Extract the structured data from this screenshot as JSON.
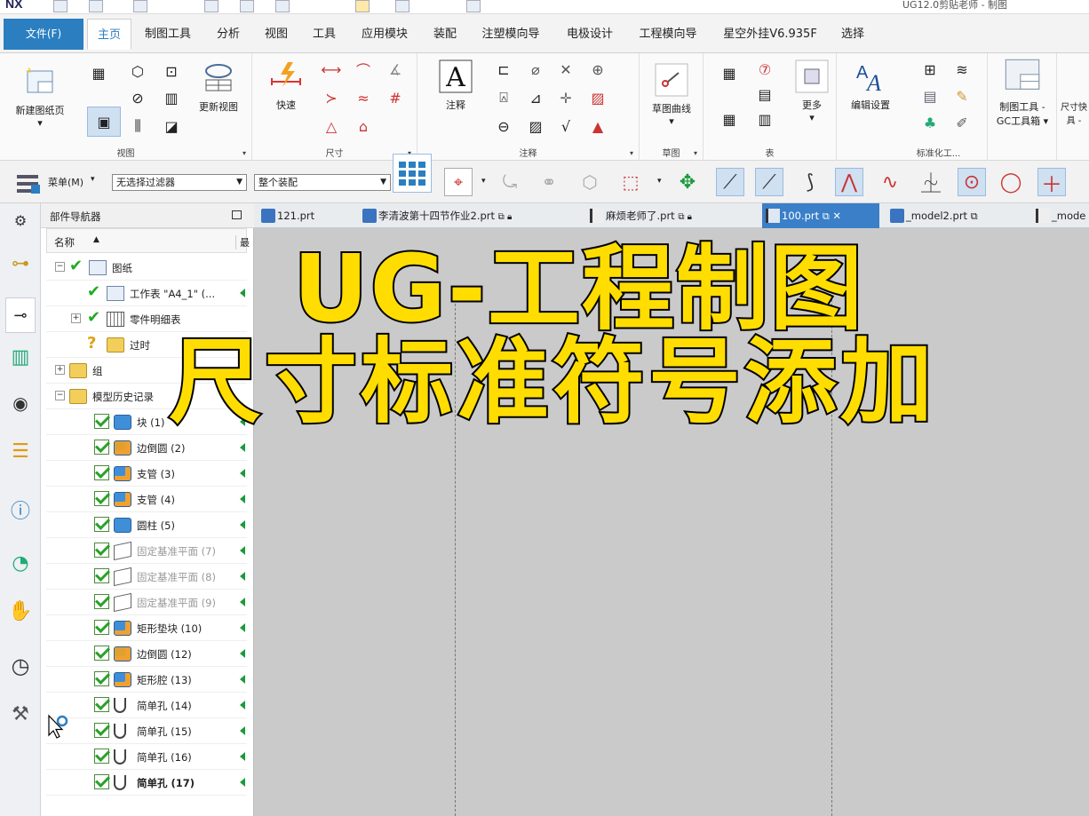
{
  "titlebar": {
    "logo": "NX",
    "window_title": "UG12.0剪贴老师 - 制图"
  },
  "menu": {
    "file": "文件(F)",
    "tabs": [
      "主页",
      "制图工具",
      "分析",
      "视图",
      "工具",
      "应用模块",
      "装配",
      "注塑模向导",
      "电极设计",
      "工程模向导",
      "星空外挂V6.935F",
      "选择"
    ],
    "active": "主页"
  },
  "ribbon": {
    "new_sheet": "新建图纸页",
    "update_view": "更新视图",
    "view_group": "视图",
    "quick": "快速",
    "dim_group": "尺寸",
    "note": "注释",
    "note_group": "注释",
    "sketch_curve": "草图曲线",
    "sketch_group": "草图",
    "more": "更多",
    "table_group": "表",
    "edit_settings": "编辑设置",
    "gc_tools": "制图工具 - GC工具箱",
    "std_group": "标准化工...",
    "dim_quick_tool": "尺寸快 具 -"
  },
  "cmdbar": {
    "menu": "菜单(M)",
    "filter": "无选择过滤器",
    "assembly": "整个装配"
  },
  "navigator": {
    "title": "部件导航器",
    "col_name": "名称",
    "col_short": "最",
    "rows": [
      {
        "label": "图纸",
        "indent": 0,
        "type": "sheet-root"
      },
      {
        "label": "工作表 \"A4_1\" (...",
        "indent": 1,
        "type": "sheet"
      },
      {
        "label": "零件明细表",
        "indent": 1,
        "type": "table"
      },
      {
        "label": "过时",
        "indent": 1,
        "type": "outdated"
      },
      {
        "label": "组",
        "indent": 0,
        "type": "group"
      },
      {
        "label": "模型历史记录",
        "indent": 0,
        "type": "history"
      },
      {
        "label": "块 (1)",
        "indent": 2,
        "type": "block",
        "style": ""
      },
      {
        "label": "边倒圆 (2)",
        "indent": 2,
        "type": "blend",
        "style": ""
      },
      {
        "label": "支管 (3)",
        "indent": 2,
        "type": "boss",
        "style": ""
      },
      {
        "label": "支管 (4)",
        "indent": 2,
        "type": "boss",
        "style": ""
      },
      {
        "label": "圆柱 (5)",
        "indent": 2,
        "type": "cylinder",
        "style": ""
      },
      {
        "label": "固定基准平面 (7)",
        "indent": 2,
        "type": "plane",
        "style": "grey"
      },
      {
        "label": "固定基准平面 (8)",
        "indent": 2,
        "type": "plane",
        "style": "grey"
      },
      {
        "label": "固定基准平面 (9)",
        "indent": 2,
        "type": "plane",
        "style": "grey"
      },
      {
        "label": "矩形垫块 (10)",
        "indent": 2,
        "type": "pad",
        "style": ""
      },
      {
        "label": "边倒圆 (12)",
        "indent": 2,
        "type": "blend",
        "style": ""
      },
      {
        "label": "矩形腔 (13)",
        "indent": 2,
        "type": "pocket",
        "style": ""
      },
      {
        "label": "简单孔 (14)",
        "indent": 2,
        "type": "hole",
        "style": ""
      },
      {
        "label": "简单孔 (15)",
        "indent": 2,
        "type": "hole",
        "style": ""
      },
      {
        "label": "简单孔 (16)",
        "indent": 2,
        "type": "hole",
        "style": ""
      },
      {
        "label": "简单孔 (17)",
        "indent": 2,
        "type": "hole",
        "style": "bold"
      }
    ]
  },
  "tabs": [
    {
      "label": "121.prt",
      "active": false
    },
    {
      "label": "李清波第十四节作业2.prt",
      "active": false
    },
    {
      "label": "麻烦老师了.prt",
      "active": false
    },
    {
      "label": "100.prt",
      "active": true
    },
    {
      "label": "_model2.prt",
      "active": false
    },
    {
      "label": "_mode",
      "active": false
    }
  ],
  "overlay": {
    "line1": "UG-工程制图",
    "line2": "尺寸标准符号添加"
  },
  "colors": {
    "accent": "#2b7fc1",
    "overlay_text": "#ffdd00",
    "canvas": "#cacaca"
  }
}
